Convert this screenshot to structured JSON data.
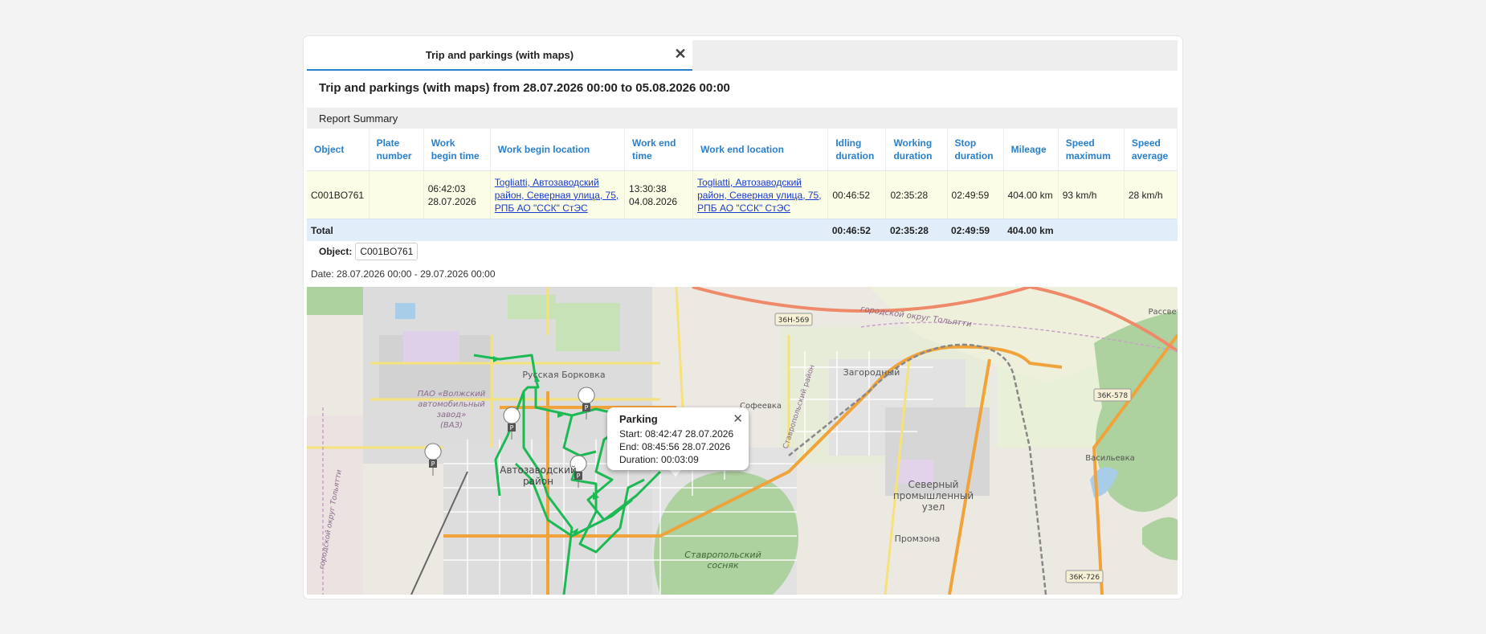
{
  "tab": {
    "label": "Trip and parkings (with maps)"
  },
  "report": {
    "title": "Trip and parkings (with maps) from 28.07.2026 00:00 to 05.08.2026 00:00",
    "summary_label": "Report Summary",
    "columns": [
      "Object",
      "Plate number",
      "Work begin time",
      "Work begin location",
      "Work end time",
      "Work end location",
      "Idling duration",
      "Working duration",
      "Stop duration",
      "Mileage",
      "Speed maximum",
      "Speed average"
    ],
    "row": {
      "object": "C001BO761",
      "plate": "",
      "begin_time": "06:42:03 28.07.2026",
      "begin_location": "Togliatti, Автозаводский район, Северная улица, 75, РПБ АО \"ССК\" СтЭС",
      "end_time": "13:30:38 04.08.2026",
      "end_location": "Togliatti, Автозаводский район, Северная улица, 75, РПБ АО \"ССК\" СтЭС",
      "idling": "00:46:52",
      "working": "02:35:28",
      "stop": "02:49:59",
      "mileage": "404.00 km",
      "speed_max": "93 km/h",
      "speed_avg": "28 km/h"
    },
    "total": {
      "label": "Total",
      "idling": "00:46:52",
      "working": "02:35:28",
      "stop": "02:49:59",
      "mileage": "404.00 km"
    }
  },
  "object_filter": {
    "label": "Object:",
    "value": "C001BO761"
  },
  "date_range": "Date: 28.07.2026 00:00 - 29.07.2026 00:00",
  "map": {
    "labels": {
      "borkovka": "Русская Борковка",
      "vaz1": "ПАО «Волжский",
      "vaz2": "автомобильный",
      "vaz3": "завод»",
      "vaz4": "(ВАЗ)",
      "avtozav1": "Автозаводский",
      "avtozav2": "район",
      "zagorodny": "Загородный",
      "sofeevka": "Софеевка",
      "stavr_rayon": "Ставропольский район",
      "okrug_top": "городской округ Тольятти",
      "okrug_left": "городской округ Тольятти",
      "vasilevka": "Васильевка",
      "sev1": "Северный",
      "sev2": "промышленный",
      "sev3": "узел",
      "promzona": "Промзона",
      "sosnyak1": "Ставропольский",
      "sosnyak2": "сосняк",
      "rassvet": "Рассвет",
      "road1": "36Н-569",
      "road2": "36К-578",
      "road3": "36К-726"
    },
    "popup": {
      "title": "Parking",
      "start": "Start: 08:42:47 28.07.2026",
      "end": "End: 08:45:56 28.07.2026",
      "duration": "Duration: 00:03:09"
    },
    "colors": {
      "track": "#1db954",
      "road_main": "#f0a33a",
      "forest": "#aed1a0"
    }
  }
}
